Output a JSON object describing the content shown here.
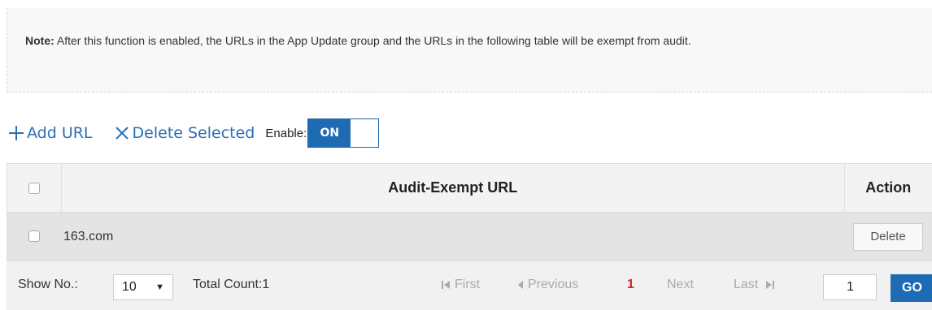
{
  "note": {
    "label": "Note:",
    "text": " After this function is enabled, the URLs in the App Update group and the URLs in the following table will be exempt from audit."
  },
  "toolbar": {
    "add_label": "Add URL",
    "delete_label": "Delete Selected",
    "enable_label": "Enable:",
    "toggle_state": "ON"
  },
  "table": {
    "columns": [
      "",
      "Audit-Exempt URL",
      "Action"
    ],
    "rows": [
      {
        "url": "163.com",
        "action": "Delete"
      }
    ]
  },
  "pager": {
    "show_label": "Show No.:",
    "page_size": "10",
    "total": "Total Count:1",
    "first": "First",
    "previous": "Previous",
    "current": "1",
    "next": "Next",
    "last": "Last",
    "page_input": "1",
    "go": "GO"
  },
  "colors": {
    "accent": "#1e6ab3",
    "link": "#2a6fb6",
    "current_page": "#e02020"
  }
}
